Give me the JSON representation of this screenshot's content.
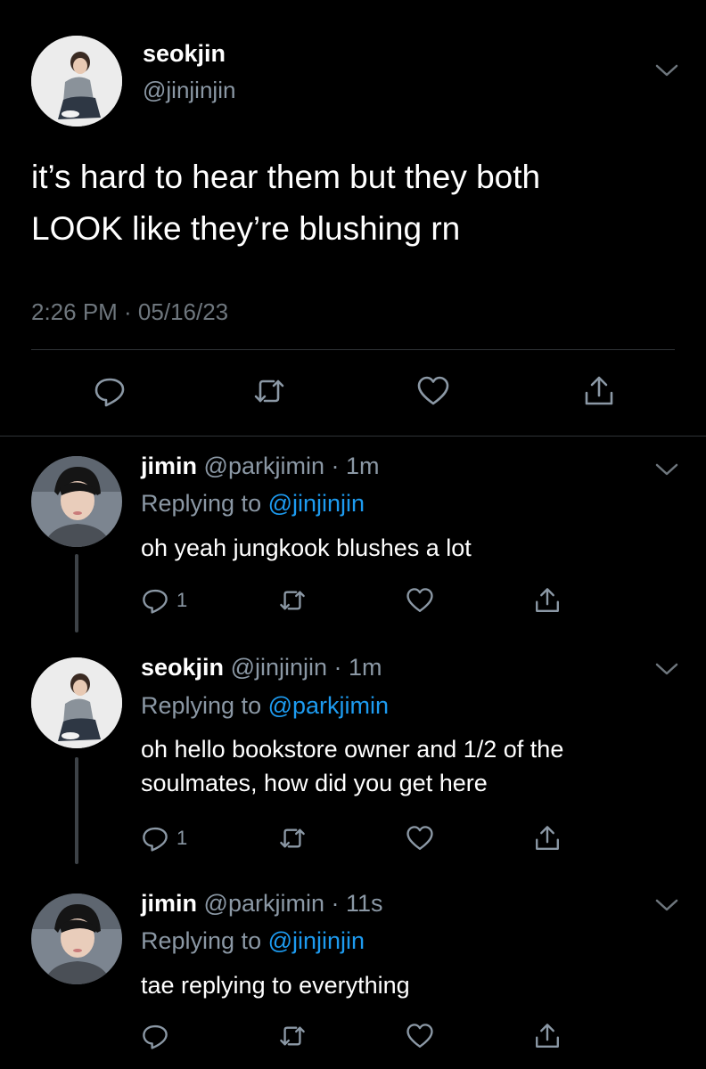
{
  "main_tweet": {
    "name": "seokjin",
    "handle": "@jinjinjin",
    "text_line1": "it’s hard to hear them but they both",
    "text_line2": "LOOK like they’re blushing rn",
    "timestamp": "2:26 PM · 05/16/23"
  },
  "replies": [
    {
      "name": "jimin",
      "meta": "@parkjimin · 1m",
      "replying_prefix": "Replying to ",
      "replying_to": "@jinjinjin",
      "text": "oh yeah jungkook blushes a lot",
      "reply_count": "1"
    },
    {
      "name": "seokjin",
      "meta": "@jinjinjin · 1m",
      "replying_prefix": "Replying to ",
      "replying_to": "@parkjimin",
      "text": "oh hello bookstore owner and 1/2 of the soulmates, how did you get here",
      "reply_count": "1"
    },
    {
      "name": "jimin",
      "meta": "@parkjimin · 11s",
      "replying_prefix": "Replying to ",
      "replying_to": "@jinjinjin",
      "text": "tae replying to everything",
      "reply_count": ""
    }
  ],
  "icons": {
    "reply": "reply-icon",
    "retweet": "retweet-icon",
    "like": "heart-icon",
    "share": "share-icon",
    "more": "chevron-down-icon"
  },
  "colors": {
    "background": "#000000",
    "secondary_text": "#8b98a5",
    "link": "#1d9bf0",
    "divider": "#2f3336"
  }
}
